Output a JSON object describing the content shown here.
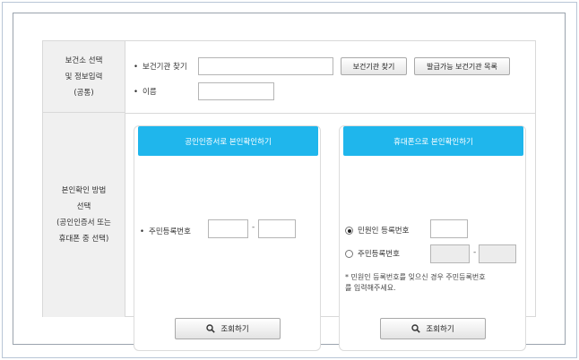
{
  "health_center": {
    "label_lines": [
      "보건소 선택",
      "및 정보입력",
      "(공통)"
    ],
    "institution_label": "보건기관 찾기",
    "institution_value": "",
    "find_button": "보건기관 찾기",
    "list_button": "발급가능 보건기관 목록",
    "name_label": "이름",
    "name_value": ""
  },
  "verification": {
    "label_lines": [
      "본인확인 방법",
      "선택",
      "(공인인증서 또는",
      "휴대폰 중 선택)"
    ],
    "certificate_panel": {
      "header": "공인인증서로 본인확인하기",
      "rrn_label": "주민등록번호",
      "rrn_front": "",
      "rrn_back": "",
      "dash": "-",
      "search_button": "조회하기"
    },
    "phone_panel": {
      "header": "휴대폰으로 본인확인하기",
      "option_applicant": "민원인 등록번호",
      "option_rrn": "주민등록번호",
      "selected": "applicant",
      "applicant_value": "",
      "rrn_front": "",
      "rrn_back": "",
      "dash": "-",
      "note_line1": "* 민원인 등록번호를 잊으신 경우 주민등록번호",
      "note_line2": "를 입력해주세요.",
      "search_button": "조회하기"
    }
  }
}
